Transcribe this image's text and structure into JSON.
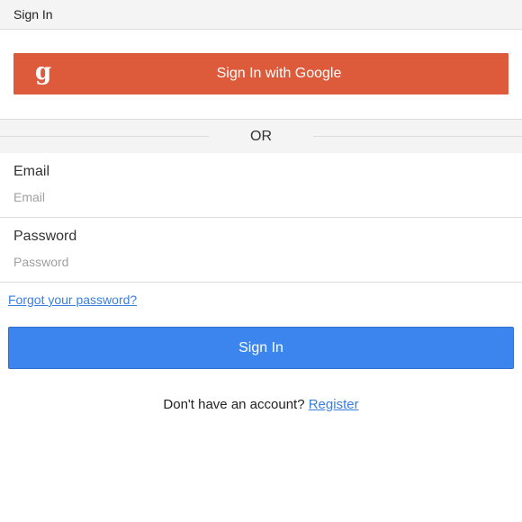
{
  "header": {
    "title": "Sign In"
  },
  "google": {
    "icon_glyph": "g",
    "icon_name": "google-icon",
    "label": "Sign In with Google",
    "color": "#dd5a3a"
  },
  "divider": {
    "text": "OR"
  },
  "email": {
    "label": "Email",
    "placeholder": "Email",
    "value": ""
  },
  "password": {
    "label": "Password",
    "placeholder": "Password",
    "value": ""
  },
  "forgot": {
    "label": "Forgot your password?"
  },
  "signin": {
    "label": "Sign In",
    "color": "#3c85ef"
  },
  "register": {
    "prompt": "Don't have an account?",
    "link_label": "Register"
  }
}
